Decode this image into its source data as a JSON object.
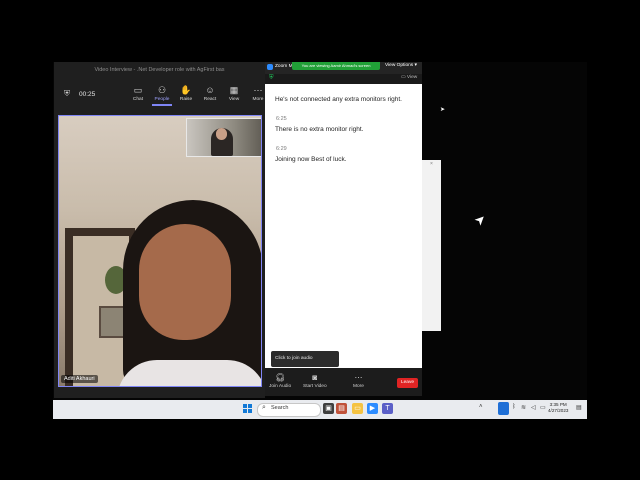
{
  "teams": {
    "window_title": "Video Interview - .Net Developer role with AgFirst bas",
    "timer": "00:25",
    "toolbar": [
      {
        "id": "chat",
        "label": "Chat",
        "icon": "chat-icon",
        "glyph": "💬"
      },
      {
        "id": "people",
        "label": "People",
        "icon": "people-icon",
        "glyph": "👥"
      },
      {
        "id": "raise",
        "label": "Raise",
        "icon": "raise-hand-icon",
        "glyph": "✋"
      },
      {
        "id": "react",
        "label": "React",
        "icon": "smiley-icon",
        "glyph": "☺"
      },
      {
        "id": "view",
        "label": "View",
        "icon": "grid-icon",
        "glyph": "▦"
      },
      {
        "id": "more",
        "label": "More",
        "icon": "more-icon",
        "glyph": "⋯"
      }
    ],
    "participant_name": "Aditi Akhauri"
  },
  "zoom": {
    "title": "Zoom M",
    "banner": "You are viewing Aamir Ahmad's screen",
    "view_options": "View Options",
    "sub_view": "View",
    "chat": [
      {
        "time": "",
        "text": "He's not connected any extra monitors right."
      },
      {
        "time": "6:25",
        "text": "There is no extra monitor right."
      },
      {
        "time": "6:29",
        "text": "Joining now Best of luck."
      }
    ],
    "tooltip": "Click to join audio",
    "controls": {
      "join_audio": "Join Audio",
      "start_video": "Start Video",
      "more": "More",
      "leave": "Leave"
    }
  },
  "taskbar": {
    "search_label": "Search",
    "time": "3:35 PM",
    "date": "4/27/2023"
  },
  "colors": {
    "accent": "#7f85f5",
    "zoom_banner": "#21a037",
    "leave": "#e02424",
    "taskbar": "#e9ebef"
  }
}
